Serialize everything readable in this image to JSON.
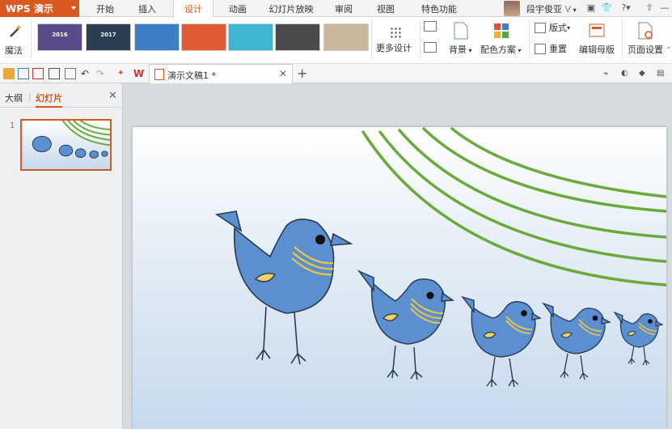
{
  "app": {
    "name": "WPS 演示"
  },
  "menu": {
    "tabs": [
      "开始",
      "插入",
      "设计",
      "动画",
      "幻灯片放映",
      "审阅",
      "视图",
      "特色功能"
    ],
    "active_tab": "设计"
  },
  "user": {
    "name": "段宇俊亚"
  },
  "ribbon": {
    "magic_label": "魔法",
    "templates": [
      {
        "text": "2016",
        "color": "#5a4a8a"
      },
      {
        "text": "2017",
        "color": "#2c3e50"
      },
      {
        "text": "",
        "color": "#3d7fc4"
      },
      {
        "text": "",
        "color": "#e05a33"
      },
      {
        "text": "",
        "color": "#3fb5d4"
      },
      {
        "text": "",
        "color": "#4a4a4a"
      },
      {
        "text": "",
        "color": "#c9b89a"
      }
    ],
    "more_design_label": "更多设计",
    "background_label": "背景",
    "color_scheme_label": "配色方案",
    "layout_label": "版式",
    "reset_label": "重置",
    "edit_master_label": "编辑母版",
    "page_setup_label": "页面设置"
  },
  "document": {
    "tab_name": "演示文稿1 *"
  },
  "side_panel": {
    "outline_tab": "大纲",
    "divider": "|",
    "slides_tab": "幻灯片",
    "slide_number": "1"
  },
  "colors": {
    "accent": "#d9581f",
    "bird_body": "#5b8fcf",
    "bird_collar": "#e8c84a",
    "arc_green": "#6aaa3a"
  }
}
